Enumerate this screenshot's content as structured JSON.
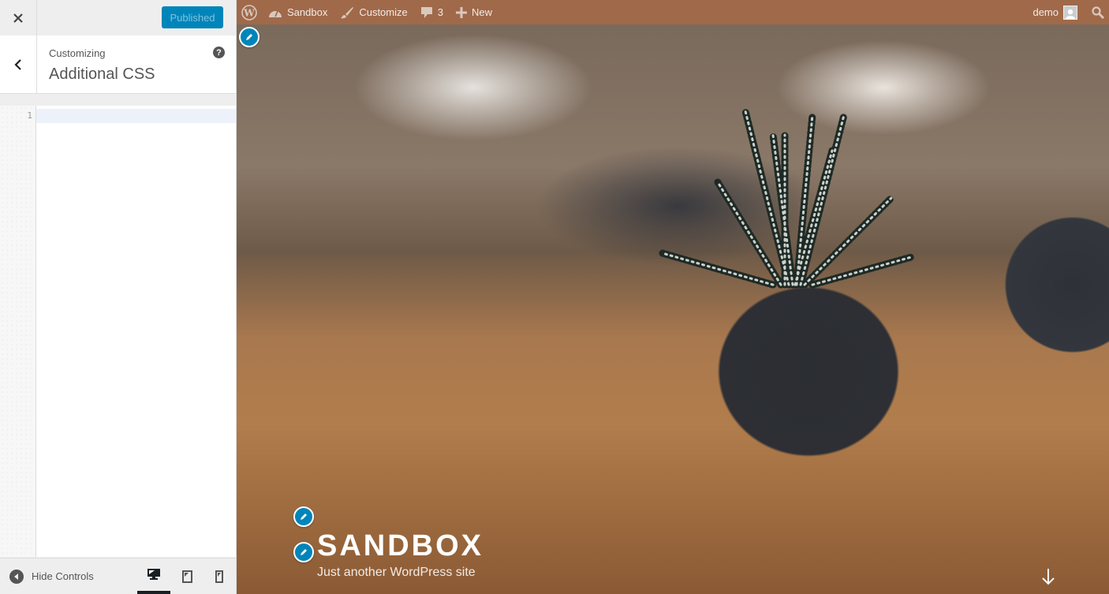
{
  "sidebar": {
    "close_icon": "close-icon",
    "publish_button": "Published",
    "breadcrumb": "Customizing",
    "section_title": "Additional CSS",
    "help_icon": "?",
    "editor": {
      "line_numbers": [
        "1"
      ],
      "value": "",
      "placeholder": ""
    },
    "footer": {
      "hide_controls_label": "Hide Controls",
      "devices": [
        {
          "name": "desktop",
          "active": true
        },
        {
          "name": "tablet",
          "active": false
        },
        {
          "name": "mobile",
          "active": false
        }
      ]
    }
  },
  "adminbar": {
    "items": [
      {
        "icon": "wordpress-logo-icon",
        "label": ""
      },
      {
        "icon": "dashboard-icon",
        "label": "Sandbox"
      },
      {
        "icon": "paintbrush-icon",
        "label": "Customize"
      },
      {
        "icon": "comment-icon",
        "label": "3"
      },
      {
        "icon": "plus-icon",
        "label": "New"
      }
    ],
    "user": "demo",
    "search_icon": "search-icon"
  },
  "preview": {
    "site_title": "SANDBOX",
    "site_description": "Just another WordPress site",
    "colors": {
      "adminbar": "#a0694a",
      "accent": "#0085ba"
    }
  }
}
